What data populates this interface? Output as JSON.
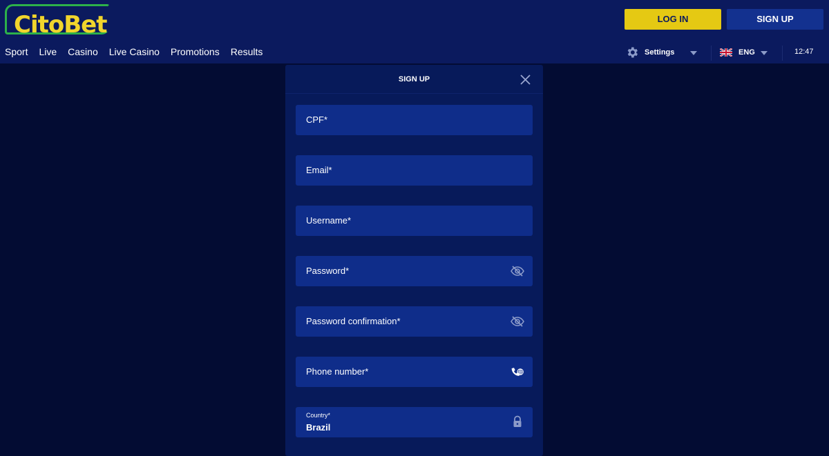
{
  "brand": {
    "logo_text": "CitoBet",
    "accent_yellow": "#e5c913",
    "accent_green": "#2db14a"
  },
  "header": {
    "login_label": "LOG IN",
    "signup_label": "SIGN UP",
    "nav": [
      {
        "label": "Sport"
      },
      {
        "label": "Live"
      },
      {
        "label": "Casino"
      },
      {
        "label": "Live Casino"
      },
      {
        "label": "Promotions"
      },
      {
        "label": "Results"
      }
    ],
    "settings_label": "Settings",
    "language": "ENG",
    "time": "12:47"
  },
  "modal": {
    "title": "SIGN UP",
    "fields": [
      {
        "label": "CPF*"
      },
      {
        "label": "Email*"
      },
      {
        "label": "Username*"
      },
      {
        "label": "Password*",
        "icon": "eye-off-icon"
      },
      {
        "label": "Password confirmation*",
        "icon": "eye-off-icon"
      },
      {
        "label": "Phone number*",
        "icon": "phone-globe-icon"
      },
      {
        "label": "Country*",
        "value": "Brazil",
        "icon": "lock-icon"
      }
    ]
  }
}
